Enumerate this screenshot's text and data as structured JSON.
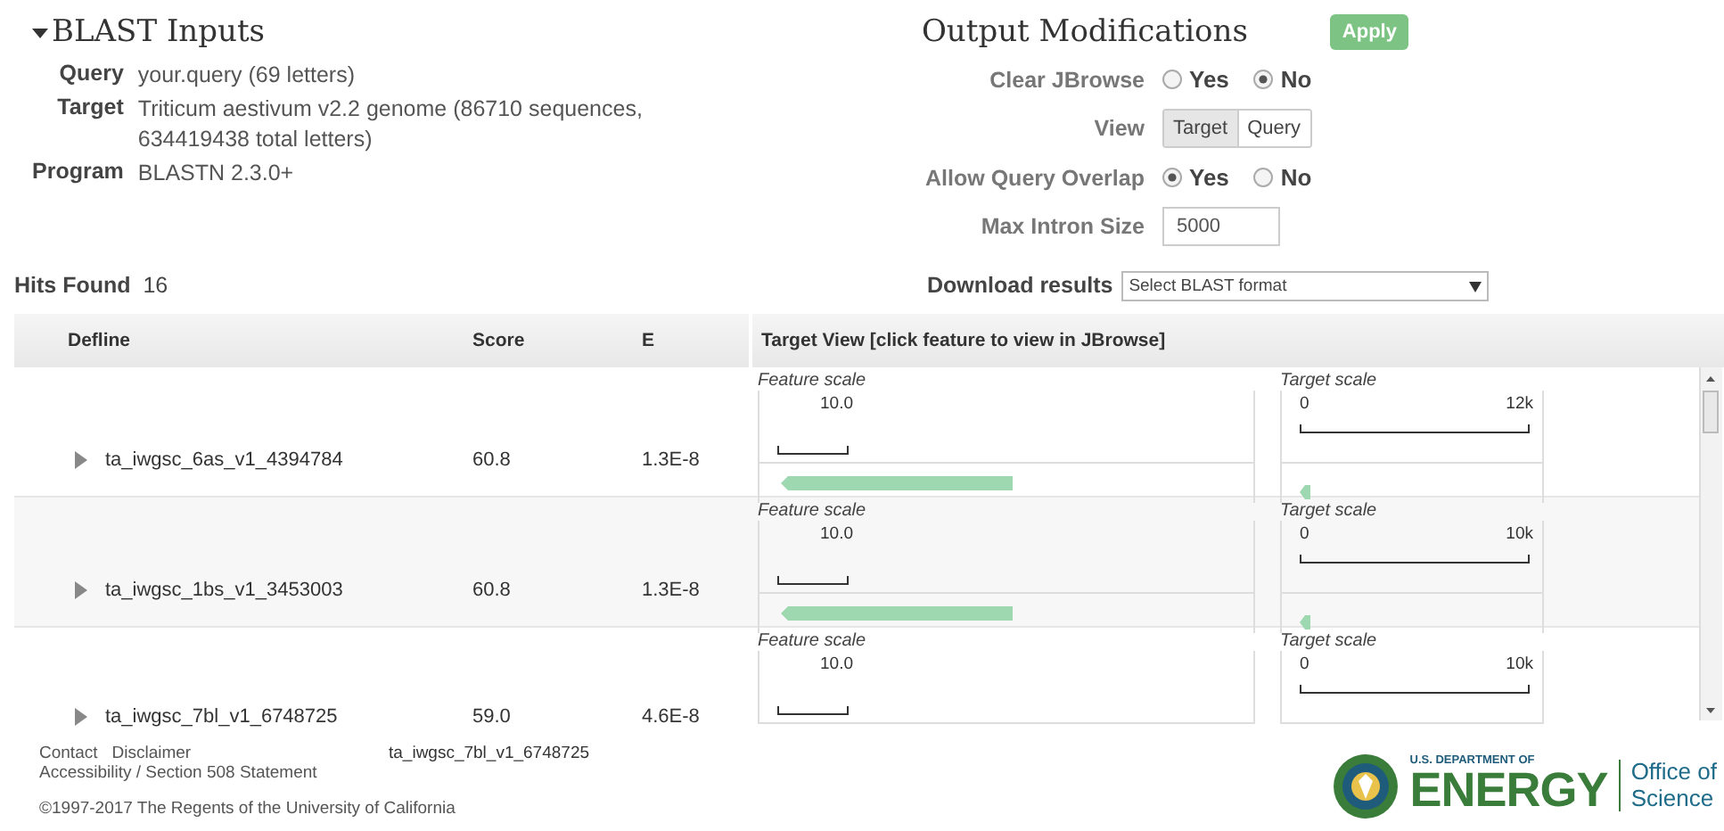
{
  "inputs": {
    "title": "BLAST Inputs",
    "expanded": true,
    "fields": [
      {
        "label": "Query",
        "value": "your.query (69 letters)"
      },
      {
        "label": "Target",
        "value": "Triticum aestivum v2.2 genome (86710 sequences, 634419438 total letters)"
      },
      {
        "label": "Program",
        "value": "BLASTN 2.3.0+"
      }
    ]
  },
  "output": {
    "title": "Output Modifications",
    "apply": "Apply",
    "clear_jbrowse": {
      "label": "Clear JBrowse",
      "options": [
        {
          "label": "Yes",
          "selected": false
        },
        {
          "label": "No",
          "selected": true
        }
      ]
    },
    "view": {
      "label": "View",
      "options": [
        {
          "label": "Target",
          "selected": true
        },
        {
          "label": "Query",
          "selected": false
        }
      ]
    },
    "allow_overlap": {
      "label": "Allow Query Overlap",
      "options": [
        {
          "label": "Yes",
          "selected": true
        },
        {
          "label": "No",
          "selected": false
        }
      ]
    },
    "max_intron": {
      "label": "Max Intron Size",
      "value": "5000"
    }
  },
  "hits": {
    "label": "Hits Found",
    "count": "16"
  },
  "download": {
    "label": "Download results",
    "value": "Select BLAST format"
  },
  "table": {
    "columns": [
      "Defline",
      "Score",
      "E",
      "Target View [click feature to view in JBrowse]"
    ],
    "rows": [
      {
        "defline": "ta_iwgsc_6as_v1_4394784",
        "score": "60.8",
        "e": "1.3E-8",
        "expanded": false,
        "feature_label": "Feature scale",
        "feature_tick": "10.0",
        "target_label": "Target scale",
        "target_min": "0",
        "target_max": "12k"
      },
      {
        "defline": "ta_iwgsc_1bs_v1_3453003",
        "score": "60.8",
        "e": "1.3E-8",
        "expanded": false,
        "feature_label": "Feature scale",
        "feature_tick": "10.0",
        "target_label": "Target scale",
        "target_min": "0",
        "target_max": "10k"
      },
      {
        "defline": "ta_iwgsc_7bl_v1_6748725",
        "score": "59.0",
        "e": "4.6E-8",
        "expanded": false,
        "feature_label": "Feature scale",
        "feature_tick": "10.0",
        "target_label": "Target scale",
        "target_min": "0",
        "target_max": "10k"
      }
    ]
  },
  "tooltip": "ta_iwgsc_7bl_v1_6748725",
  "footer": {
    "links": [
      "Contact",
      "Disclaimer"
    ],
    "accessibility": "Accessibility / Section 508 Statement",
    "copyright": "©1997-2017 The Regents of the University of California",
    "logo": {
      "top": "U.S. DEPARTMENT OF",
      "main": "ENERGY"
    },
    "office": [
      "Office of",
      "Science"
    ]
  }
}
